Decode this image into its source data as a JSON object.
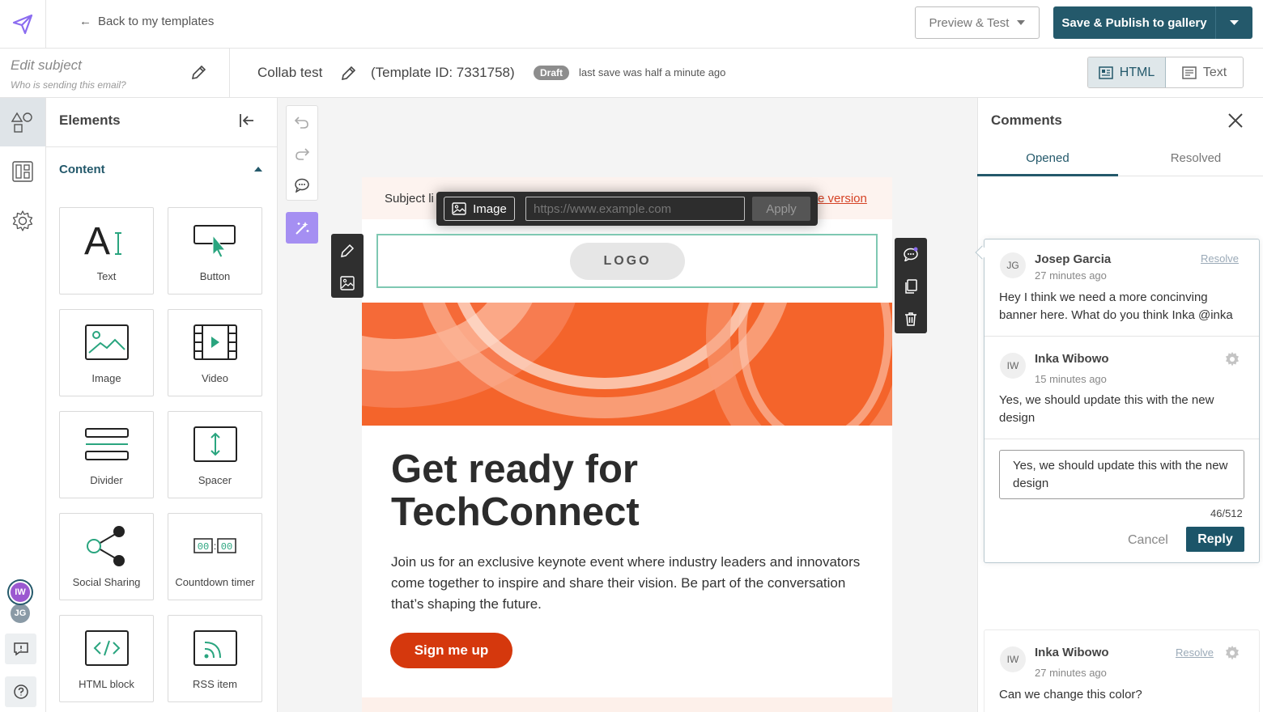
{
  "topbar": {
    "back_label": "Back to my templates",
    "preview_label": "Preview & Test",
    "publish_label": "Save & Publish to gallery"
  },
  "subject": {
    "title": "Edit subject",
    "subtitle": "Who is sending this email?"
  },
  "template": {
    "name": "Collab test",
    "id_label": "(Template ID: 7331758)",
    "status": "Draft",
    "last_save": "last save was half a minute ago"
  },
  "view_toggle": {
    "html": "HTML",
    "text": "Text",
    "active": "html"
  },
  "rail": {
    "items": [
      "shapes-icon",
      "layout-icon",
      "settings-icon"
    ],
    "avatars": [
      {
        "initials": "IW",
        "color": "#9b59d0"
      },
      {
        "initials": "JG",
        "color": "#8a9aa6"
      }
    ]
  },
  "elements": {
    "title": "Elements",
    "section": "Content",
    "items": [
      {
        "label": "Text",
        "icon": "text-icon"
      },
      {
        "label": "Button",
        "icon": "button-icon"
      },
      {
        "label": "Image",
        "icon": "image-icon"
      },
      {
        "label": "Video",
        "icon": "video-icon"
      },
      {
        "label": "Divider",
        "icon": "divider-icon"
      },
      {
        "label": "Spacer",
        "icon": "spacer-icon"
      },
      {
        "label": "Social Sharing",
        "icon": "share-icon"
      },
      {
        "label": "Countdown timer",
        "icon": "countdown-icon"
      },
      {
        "label": "HTML block",
        "icon": "code-icon"
      },
      {
        "label": "RSS item",
        "icon": "rss-icon"
      }
    ]
  },
  "canvas": {
    "preheader_subject": "Subject li",
    "preheader_web": "e version",
    "image_toolbar": {
      "chip": "Image",
      "url_placeholder": "https://www.example.com",
      "apply": "Apply"
    },
    "logo": "LOGO",
    "headline": "Get ready for TechConnect",
    "body": "Join us for an exclusive keynote event where industry leaders and innovators come together to inspire and share their vision. Be part of the conversation that’s shaping the future.",
    "cta": "Sign me up",
    "colors": {
      "banner": "#f4642b",
      "cta": "#d5380d",
      "accent": "#24596b"
    }
  },
  "comments": {
    "title": "Comments",
    "tabs": [
      "Opened",
      "Resolved"
    ],
    "thread": [
      {
        "initials": "JG",
        "name": "Josep Garcia",
        "time": "27 minutes ago",
        "text": "Hey I think we need a more concinving banner here. What do you think Inka @inka",
        "resolve": "Resolve"
      },
      {
        "initials": "IW",
        "name": "Inka Wibowo",
        "time": "15 minutes ago",
        "text": "Yes, we should update this with the new design"
      }
    ],
    "reply": {
      "value": "Yes, we should update this with the new design",
      "count": "46/512",
      "cancel": "Cancel",
      "submit": "Reply"
    },
    "thread2": {
      "initials": "IW",
      "name": "Inka Wibowo",
      "time": "27 minutes ago",
      "text": "Can we change this color?",
      "resolve": "Resolve"
    }
  }
}
